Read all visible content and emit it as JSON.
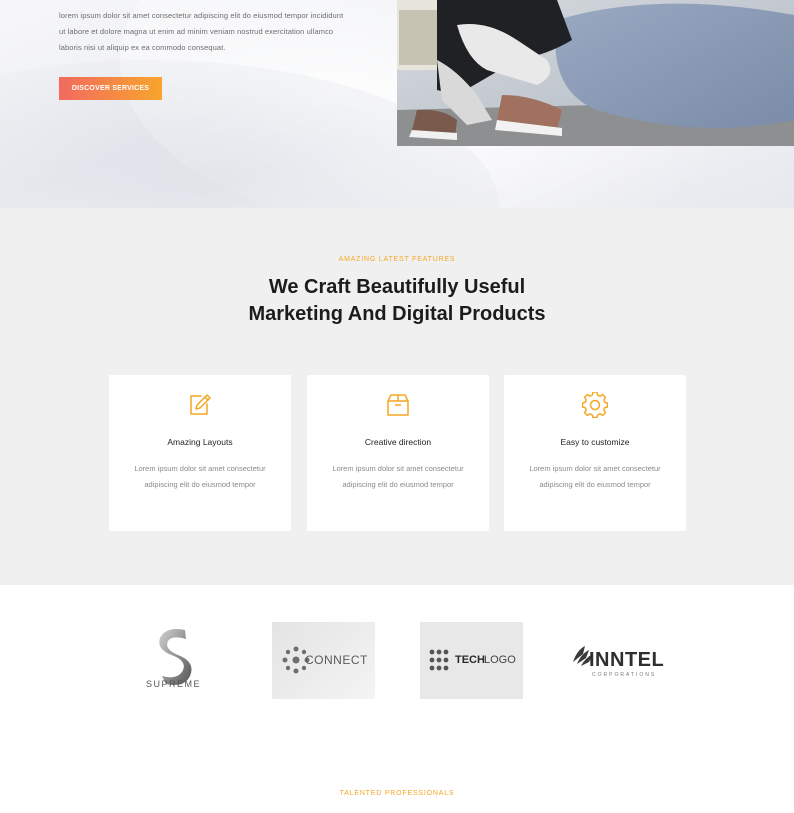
{
  "hero": {
    "text": "lorem ipsum dolor sit amet consectetur adipiscing elit do eiusmod tempor incididunt ut labore et dolore magna ut enim ad minim veniam nostrud exercitation ullamco laboris nisi ut aliquip ex ea commodo consequat.",
    "button_label": "DISCOVER SERVICES",
    "accent_gradient": [
      "#f26a5f",
      "#f7a52d"
    ]
  },
  "features": {
    "eyebrow": "AMAZING LATEST FEATURES",
    "title_line1": "We Craft Beautifully Useful",
    "title_line2": "Marketing And Digital Products",
    "cards": [
      {
        "icon": "edit-icon",
        "title": "Amazing Layouts",
        "desc": "Lorem ipsum dolor sit amet consectetur adipiscing elit do eiusmod tempor"
      },
      {
        "icon": "box-icon",
        "title": "Creative direction",
        "desc": "Lorem ipsum dolor sit amet consectetur adipiscing elit do eiusmod tempor"
      },
      {
        "icon": "gear-icon",
        "title": "Easy to customize",
        "desc": "Lorem ipsum dolor sit amet consectetur adipiscing elit do eiusmod tempor"
      }
    ],
    "accent_color": "#f5a623"
  },
  "logos": {
    "items": [
      {
        "name": "SUPREME"
      },
      {
        "name": "CONNECT"
      },
      {
        "name_bold": "TECH",
        "name_light": "LOGO"
      },
      {
        "name": "INNTEL",
        "sub": "CORPORATIONS"
      }
    ]
  },
  "professionals": {
    "eyebrow": "TALENTED PROFESSIONALS"
  }
}
